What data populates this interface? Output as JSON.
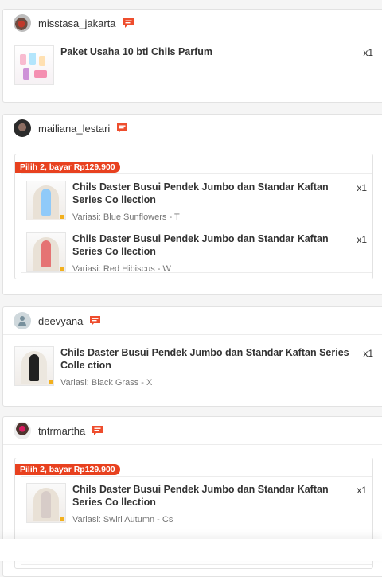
{
  "orders": [
    {
      "username": "misstasa_jakarta",
      "items": [
        {
          "name": "Paket Usaha 10 btl Chils Parfum",
          "variant": "",
          "qty": "x1"
        }
      ]
    },
    {
      "username": "mailiana_lestari",
      "bundle_label": "Pilih 2, bayar Rp129.900",
      "items": [
        {
          "name": "Chils Daster Busui Pendek Jumbo dan Standar Kaftan Series Co llection",
          "variant": "Variasi: Blue Sunflowers - T",
          "qty": "x1"
        },
        {
          "name": "Chils Daster Busui Pendek Jumbo dan Standar Kaftan Series Co llection",
          "variant": "Variasi: Red Hibiscus - W",
          "qty": "x1"
        }
      ]
    },
    {
      "username": "deevyana",
      "items": [
        {
          "name": "Chils Daster Busui Pendek Jumbo dan Standar Kaftan Series Colle ction",
          "variant": "Variasi: Black Grass - X",
          "qty": "x1"
        }
      ]
    },
    {
      "username": "tntrmartha",
      "bundle_label": "Pilih 2, bayar Rp129.900",
      "items": [
        {
          "name": "Chils Daster Busui Pendek Jumbo dan Standar Kaftan Series Co llection",
          "variant": "Variasi: Swirl Autumn - Cs",
          "qty": "x1"
        }
      ]
    }
  ],
  "colors": {
    "accent": "#e8411f",
    "chat_icon": "#ee4d2d"
  },
  "icons": {
    "chat": "chat-bubble-icon"
  }
}
